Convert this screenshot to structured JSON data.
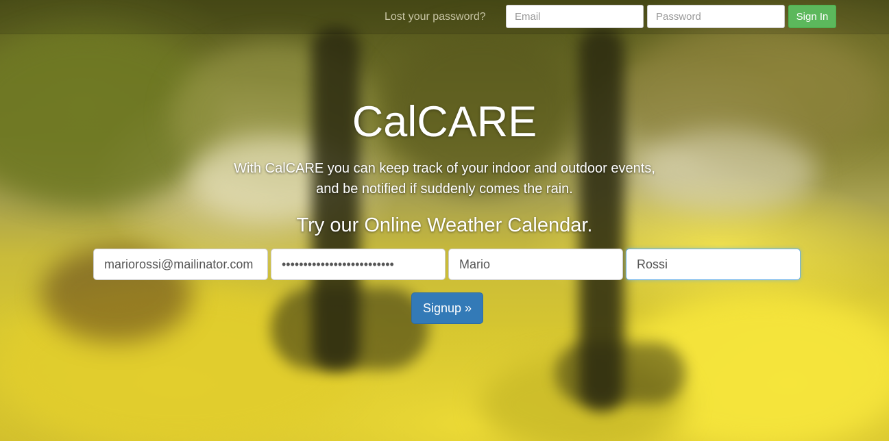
{
  "topbar": {
    "lost_password": "Lost your password?",
    "email_placeholder": "Email",
    "password_placeholder": "Password",
    "signin_label": "Sign In"
  },
  "hero": {
    "title": "CalCARE",
    "description_line1": "With CalCARE you can keep track of your indoor and outdoor events,",
    "description_line2": "and be notified if suddenly comes the rain.",
    "subtitle": "Try our Online Weather Calendar."
  },
  "signup": {
    "email_value": "mariorossi@mailinator.com",
    "password_value": "••••••••••••••••••••••••••",
    "firstname_value": "Mario",
    "lastname_value": "Rossi",
    "button_label": "Signup »"
  },
  "colors": {
    "signin_green": "#5cb85c",
    "signup_blue": "#337ab7",
    "focus_border": "#66afe9"
  }
}
